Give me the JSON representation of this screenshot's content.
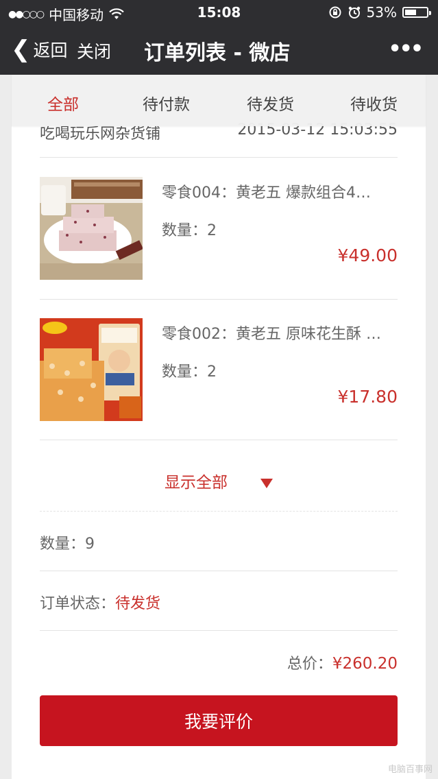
{
  "status_bar": {
    "carrier": "中国移动",
    "time": "15:08",
    "battery": "53%",
    "battery_level": 0.53
  },
  "nav": {
    "back_label": "返回",
    "close_label": "关闭",
    "title": "订单列表 - 微店",
    "more_label": "•••"
  },
  "tabs": [
    {
      "label": "全部",
      "active": true
    },
    {
      "label": "待付款",
      "active": false
    },
    {
      "label": "待发货",
      "active": false
    },
    {
      "label": "待收货",
      "active": false
    }
  ],
  "order": {
    "shop_name_partial": "吃喝玩乐网杂货铺",
    "time_partial": "2015-03-12 15:03:55",
    "items": [
      {
        "name": "零食004：黄老五 爆款组合4…",
        "qty": "数量：2",
        "price": "¥49.00"
      },
      {
        "name": "零食002：黄老五 原味花生酥 …",
        "qty": "数量：2",
        "price": "¥17.80"
      }
    ],
    "show_all": "显示全部",
    "total_qty": "数量：9",
    "status_label": "订单状态：",
    "status_value": "待发货",
    "total_label": "总价：",
    "total_value": "¥260.20",
    "review_button": "我要评价"
  },
  "watermark": "电脑百事网"
}
